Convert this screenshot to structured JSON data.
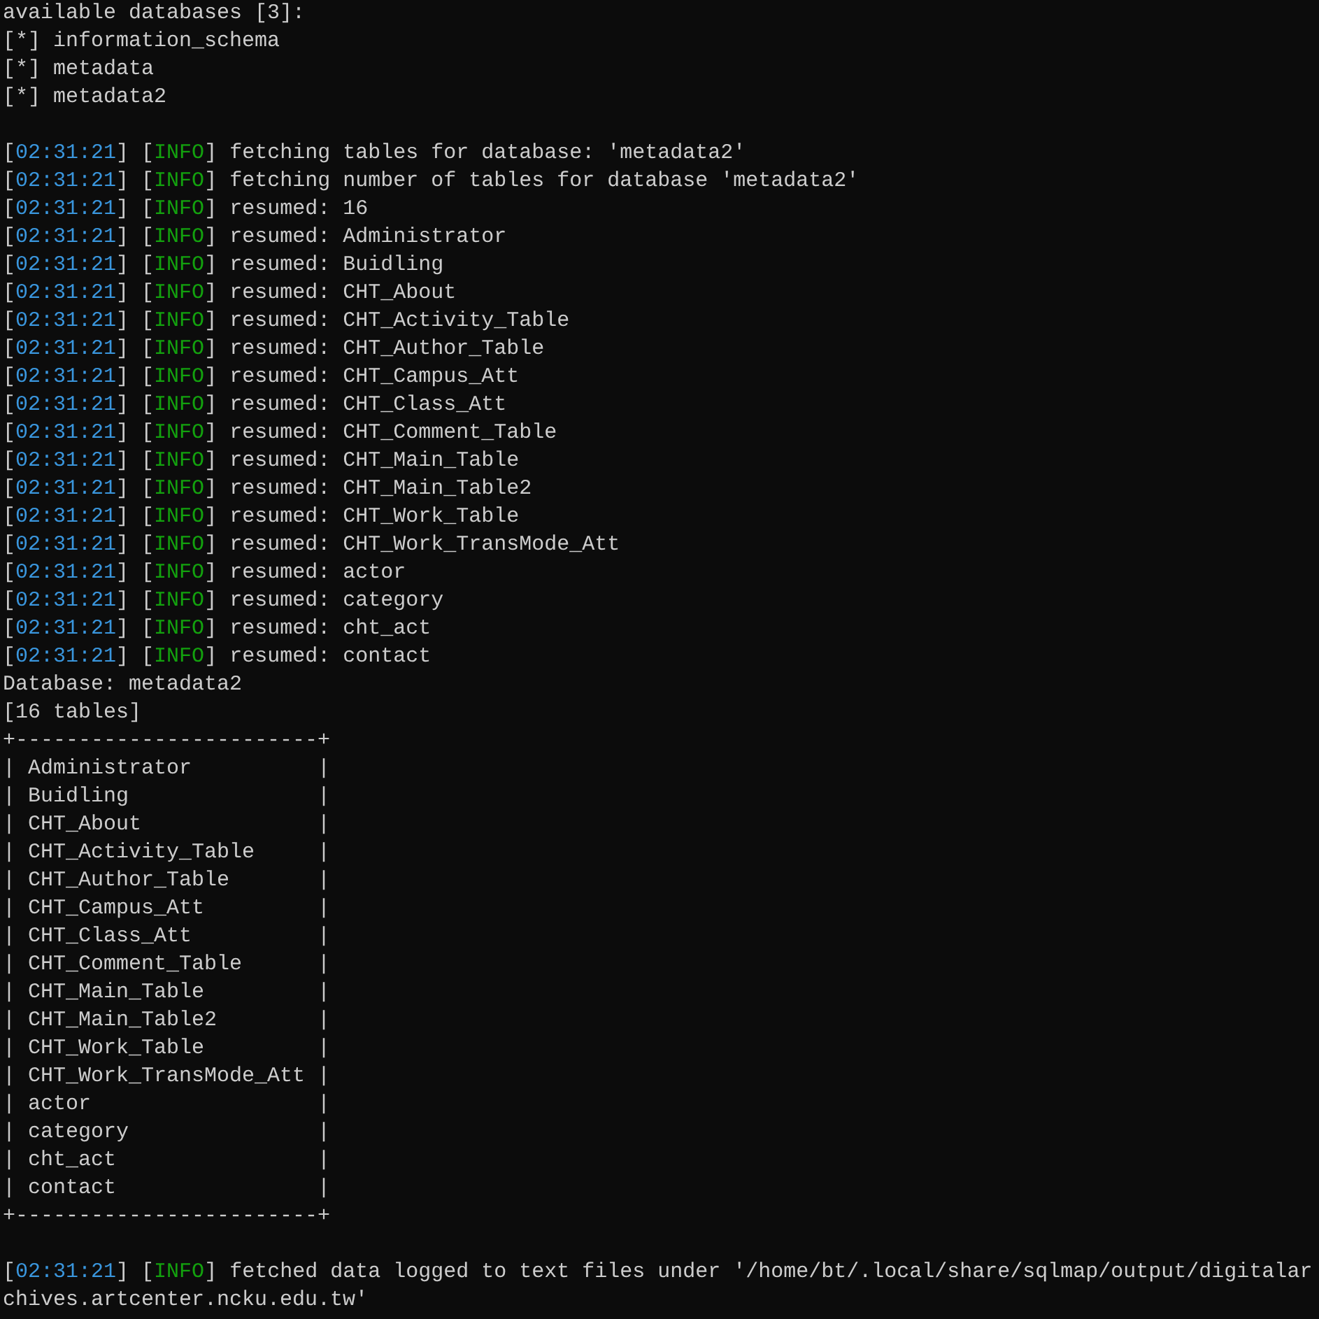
{
  "terminal": {
    "lines": [
      {
        "kind": "text",
        "text": "available databases [3]:"
      },
      {
        "kind": "text",
        "text": "[*] information_schema"
      },
      {
        "kind": "text",
        "text": "[*] metadata"
      },
      {
        "kind": "text",
        "text": "[*] metadata2"
      },
      {
        "kind": "blank"
      },
      {
        "kind": "log",
        "parts": [
          {
            "kind": "plain",
            "text": "["
          },
          {
            "kind": "time",
            "text": "02:31:21"
          },
          {
            "kind": "plain",
            "text": "] ["
          },
          {
            "kind": "level",
            "text": "INFO"
          },
          {
            "kind": "plain",
            "text": "] fetching tables for database: 'metadata2'"
          }
        ]
      },
      {
        "kind": "log",
        "parts": [
          {
            "kind": "plain",
            "text": "["
          },
          {
            "kind": "time",
            "text": "02:31:21"
          },
          {
            "kind": "plain",
            "text": "] ["
          },
          {
            "kind": "level",
            "text": "INFO"
          },
          {
            "kind": "plain",
            "text": "] fetching number of tables for database 'metadata2'"
          }
        ]
      },
      {
        "kind": "log",
        "parts": [
          {
            "kind": "plain",
            "text": "["
          },
          {
            "kind": "time",
            "text": "02:31:21"
          },
          {
            "kind": "plain",
            "text": "] ["
          },
          {
            "kind": "level",
            "text": "INFO"
          },
          {
            "kind": "plain",
            "text": "] resumed: 16"
          }
        ]
      },
      {
        "kind": "log",
        "parts": [
          {
            "kind": "plain",
            "text": "["
          },
          {
            "kind": "time",
            "text": "02:31:21"
          },
          {
            "kind": "plain",
            "text": "] ["
          },
          {
            "kind": "level",
            "text": "INFO"
          },
          {
            "kind": "plain",
            "text": "] resumed: Administrator"
          }
        ]
      },
      {
        "kind": "log",
        "parts": [
          {
            "kind": "plain",
            "text": "["
          },
          {
            "kind": "time",
            "text": "02:31:21"
          },
          {
            "kind": "plain",
            "text": "] ["
          },
          {
            "kind": "level",
            "text": "INFO"
          },
          {
            "kind": "plain",
            "text": "] resumed: Buidling"
          }
        ]
      },
      {
        "kind": "log",
        "parts": [
          {
            "kind": "plain",
            "text": "["
          },
          {
            "kind": "time",
            "text": "02:31:21"
          },
          {
            "kind": "plain",
            "text": "] ["
          },
          {
            "kind": "level",
            "text": "INFO"
          },
          {
            "kind": "plain",
            "text": "] resumed: CHT_About"
          }
        ]
      },
      {
        "kind": "log",
        "parts": [
          {
            "kind": "plain",
            "text": "["
          },
          {
            "kind": "time",
            "text": "02:31:21"
          },
          {
            "kind": "plain",
            "text": "] ["
          },
          {
            "kind": "level",
            "text": "INFO"
          },
          {
            "kind": "plain",
            "text": "] resumed: CHT_Activity_Table"
          }
        ]
      },
      {
        "kind": "log",
        "parts": [
          {
            "kind": "plain",
            "text": "["
          },
          {
            "kind": "time",
            "text": "02:31:21"
          },
          {
            "kind": "plain",
            "text": "] ["
          },
          {
            "kind": "level",
            "text": "INFO"
          },
          {
            "kind": "plain",
            "text": "] resumed: CHT_Author_Table"
          }
        ]
      },
      {
        "kind": "log",
        "parts": [
          {
            "kind": "plain",
            "text": "["
          },
          {
            "kind": "time",
            "text": "02:31:21"
          },
          {
            "kind": "plain",
            "text": "] ["
          },
          {
            "kind": "level",
            "text": "INFO"
          },
          {
            "kind": "plain",
            "text": "] resumed: CHT_Campus_Att"
          }
        ]
      },
      {
        "kind": "log",
        "parts": [
          {
            "kind": "plain",
            "text": "["
          },
          {
            "kind": "time",
            "text": "02:31:21"
          },
          {
            "kind": "plain",
            "text": "] ["
          },
          {
            "kind": "level",
            "text": "INFO"
          },
          {
            "kind": "plain",
            "text": "] resumed: CHT_Class_Att"
          }
        ]
      },
      {
        "kind": "log",
        "parts": [
          {
            "kind": "plain",
            "text": "["
          },
          {
            "kind": "time",
            "text": "02:31:21"
          },
          {
            "kind": "plain",
            "text": "] ["
          },
          {
            "kind": "level",
            "text": "INFO"
          },
          {
            "kind": "plain",
            "text": "] resumed: CHT_Comment_Table"
          }
        ]
      },
      {
        "kind": "log",
        "parts": [
          {
            "kind": "plain",
            "text": "["
          },
          {
            "kind": "time",
            "text": "02:31:21"
          },
          {
            "kind": "plain",
            "text": "] ["
          },
          {
            "kind": "level",
            "text": "INFO"
          },
          {
            "kind": "plain",
            "text": "] resumed: CHT_Main_Table"
          }
        ]
      },
      {
        "kind": "log",
        "parts": [
          {
            "kind": "plain",
            "text": "["
          },
          {
            "kind": "time",
            "text": "02:31:21"
          },
          {
            "kind": "plain",
            "text": "] ["
          },
          {
            "kind": "level",
            "text": "INFO"
          },
          {
            "kind": "plain",
            "text": "] resumed: CHT_Main_Table2"
          }
        ]
      },
      {
        "kind": "log",
        "parts": [
          {
            "kind": "plain",
            "text": "["
          },
          {
            "kind": "time",
            "text": "02:31:21"
          },
          {
            "kind": "plain",
            "text": "] ["
          },
          {
            "kind": "level",
            "text": "INFO"
          },
          {
            "kind": "plain",
            "text": "] resumed: CHT_Work_Table"
          }
        ]
      },
      {
        "kind": "log",
        "parts": [
          {
            "kind": "plain",
            "text": "["
          },
          {
            "kind": "time",
            "text": "02:31:21"
          },
          {
            "kind": "plain",
            "text": "] ["
          },
          {
            "kind": "level",
            "text": "INFO"
          },
          {
            "kind": "plain",
            "text": "] resumed: CHT_Work_TransMode_Att"
          }
        ]
      },
      {
        "kind": "log",
        "parts": [
          {
            "kind": "plain",
            "text": "["
          },
          {
            "kind": "time",
            "text": "02:31:21"
          },
          {
            "kind": "plain",
            "text": "] ["
          },
          {
            "kind": "level",
            "text": "INFO"
          },
          {
            "kind": "plain",
            "text": "] resumed: actor"
          }
        ]
      },
      {
        "kind": "log",
        "parts": [
          {
            "kind": "plain",
            "text": "["
          },
          {
            "kind": "time",
            "text": "02:31:21"
          },
          {
            "kind": "plain",
            "text": "] ["
          },
          {
            "kind": "level",
            "text": "INFO"
          },
          {
            "kind": "plain",
            "text": "] resumed: category"
          }
        ]
      },
      {
        "kind": "log",
        "parts": [
          {
            "kind": "plain",
            "text": "["
          },
          {
            "kind": "time",
            "text": "02:31:21"
          },
          {
            "kind": "plain",
            "text": "] ["
          },
          {
            "kind": "level",
            "text": "INFO"
          },
          {
            "kind": "plain",
            "text": "] resumed: cht_act"
          }
        ]
      },
      {
        "kind": "log",
        "parts": [
          {
            "kind": "plain",
            "text": "["
          },
          {
            "kind": "time",
            "text": "02:31:21"
          },
          {
            "kind": "plain",
            "text": "] ["
          },
          {
            "kind": "level",
            "text": "INFO"
          },
          {
            "kind": "plain",
            "text": "] resumed: contact"
          }
        ]
      },
      {
        "kind": "text",
        "text": "Database: metadata2"
      },
      {
        "kind": "text",
        "text": "[16 tables]"
      },
      {
        "kind": "table_border",
        "text": "+------------------------+"
      },
      {
        "kind": "table_row",
        "text": "| Administrator          |"
      },
      {
        "kind": "table_row",
        "text": "| Buidling               |"
      },
      {
        "kind": "table_row",
        "text": "| CHT_About              |"
      },
      {
        "kind": "table_row",
        "text": "| CHT_Activity_Table     |"
      },
      {
        "kind": "table_row",
        "text": "| CHT_Author_Table       |"
      },
      {
        "kind": "table_row",
        "text": "| CHT_Campus_Att         |"
      },
      {
        "kind": "table_row",
        "text": "| CHT_Class_Att          |"
      },
      {
        "kind": "table_row",
        "text": "| CHT_Comment_Table      |"
      },
      {
        "kind": "table_row",
        "text": "| CHT_Main_Table         |"
      },
      {
        "kind": "table_row",
        "text": "| CHT_Main_Table2        |"
      },
      {
        "kind": "table_row",
        "text": "| CHT_Work_Table         |"
      },
      {
        "kind": "table_row",
        "text": "| CHT_Work_TransMode_Att |"
      },
      {
        "kind": "table_row",
        "text": "| actor                  |"
      },
      {
        "kind": "table_row",
        "text": "| category               |"
      },
      {
        "kind": "table_row",
        "text": "| cht_act                |"
      },
      {
        "kind": "table_row",
        "text": "| contact                |"
      },
      {
        "kind": "table_border",
        "text": "+------------------------+"
      },
      {
        "kind": "blank"
      },
      {
        "kind": "log",
        "parts": [
          {
            "kind": "plain",
            "text": "["
          },
          {
            "kind": "time",
            "text": "02:31:21"
          },
          {
            "kind": "plain",
            "text": "] ["
          },
          {
            "kind": "level",
            "text": "INFO"
          },
          {
            "kind": "plain",
            "text": "] fetched data logged to text files under '/home/bt/.local/share/sqlmap/output/digitalarchives.artcenter.ncku.edu.tw'"
          }
        ]
      }
    ]
  }
}
